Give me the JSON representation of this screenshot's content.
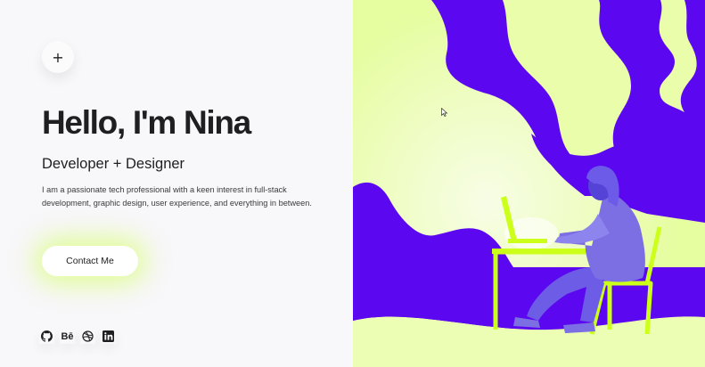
{
  "menu": {
    "icon": "plus-icon",
    "glyph": "+"
  },
  "hero": {
    "title": "Hello, I'm Nina",
    "subtitle": "Developer + Designer",
    "bio": "I am a passionate tech professional with a keen interest in full-stack development, graphic design, user experience, and everything in between."
  },
  "cta": {
    "label": "Contact Me"
  },
  "socials": [
    {
      "name": "github",
      "icon": "github-icon"
    },
    {
      "name": "behance",
      "icon": "behance-icon",
      "glyph": "Bē"
    },
    {
      "name": "dribbble",
      "icon": "dribbble-icon"
    },
    {
      "name": "linkedin",
      "icon": "linkedin-icon",
      "glyph": "in"
    }
  ],
  "colors": {
    "accent_purple": "#5b07ef",
    "accent_lime": "#ecfdb4",
    "lime_glow": "#d6ff6e",
    "chair_lime": "#ccff1a",
    "figure_lavender": "#7b6fe3",
    "text": "#1f1f22",
    "background": "#f8f7fa"
  }
}
